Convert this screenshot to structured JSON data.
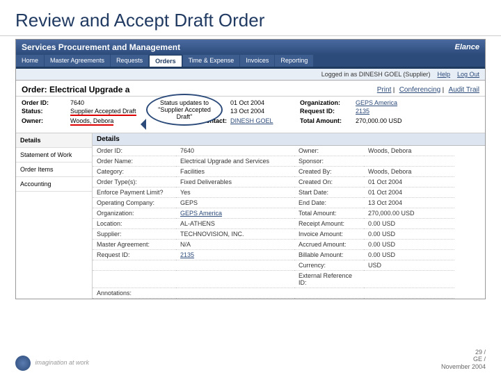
{
  "slide": {
    "title": "Review and Accept Draft Order"
  },
  "app": {
    "title": "Services Procurement and Management",
    "brand": "Elance"
  },
  "tabs": [
    "Home",
    "Master Agreements",
    "Requests",
    "Orders",
    "Time & Expense",
    "Invoices",
    "Reporting"
  ],
  "active_tab": "Orders",
  "subbar": {
    "logged": "Logged in as DINESH GOEL (Supplier)",
    "help": "Help",
    "logout": "Log Out"
  },
  "order_header": {
    "title": "Order: Electrical Upgrade a",
    "links": [
      "Print",
      "Conferencing",
      "Audit Trail"
    ]
  },
  "callout": {
    "text": "Status updates to \"Supplier Accepted Draft\""
  },
  "info": {
    "order_id_lbl": "Order ID:",
    "order_id": "7640",
    "status_lbl": "Status:",
    "status": "Supplier Accepted Draft",
    "owner_lbl": "Owner:",
    "owner": "Woods, Debora",
    "start_lbl": "Start Date:",
    "start": "01 Oct 2004",
    "end_lbl": "End Date:",
    "end": "13 Oct 2004",
    "sc_lbl": "Supplier Contact:",
    "sc": "DINESH GOEL",
    "org_lbl": "Organization:",
    "org": "GEPS America",
    "req_lbl": "Request ID:",
    "req": "2135",
    "total_lbl": "Total Amount:",
    "total": "270,000.00 USD"
  },
  "sidenav": [
    "Details",
    "Statement of Work",
    "Order Items",
    "Accounting"
  ],
  "details_title": "Details",
  "details": [
    [
      "Order ID:",
      "7640",
      "Owner:",
      "Woods, Debora"
    ],
    [
      "Order Name:",
      "Electrical Upgrade and Services",
      "Sponsor:",
      ""
    ],
    [
      "Category:",
      "Facilities",
      "Created By:",
      "Woods, Debora"
    ],
    [
      "Order Type(s):",
      "Fixed Deliverables",
      "Created On:",
      "01 Oct 2004"
    ],
    [
      "Enforce Payment Limit?",
      "Yes",
      "Start Date:",
      "01 Oct 2004"
    ],
    [
      "Operating Company:",
      "GEPS",
      "End Date:",
      "13 Oct 2004"
    ],
    [
      "Organization:",
      "GEPS America",
      "Total Amount:",
      "270,000.00 USD"
    ],
    [
      "Location:",
      "AL-ATHENS",
      "Receipt Amount:",
      "0.00 USD"
    ],
    [
      "Supplier:",
      "TECHNOVISION, INC.",
      "Invoice Amount:",
      "0.00 USD"
    ],
    [
      "Master Agreement:",
      "N/A",
      "Accrued Amount:",
      "0.00 USD"
    ],
    [
      "Request ID:",
      "2135",
      "Billable Amount:",
      "0.00 USD"
    ],
    [
      "",
      "",
      "Currency:",
      "USD"
    ],
    [
      "",
      "",
      "External Reference ID:",
      ""
    ],
    [
      "Annotations:",
      "",
      "",
      ""
    ]
  ],
  "footer": {
    "slogan": "imagination at work",
    "page": "29 /",
    "org": "GE /",
    "date": "November 2004"
  }
}
